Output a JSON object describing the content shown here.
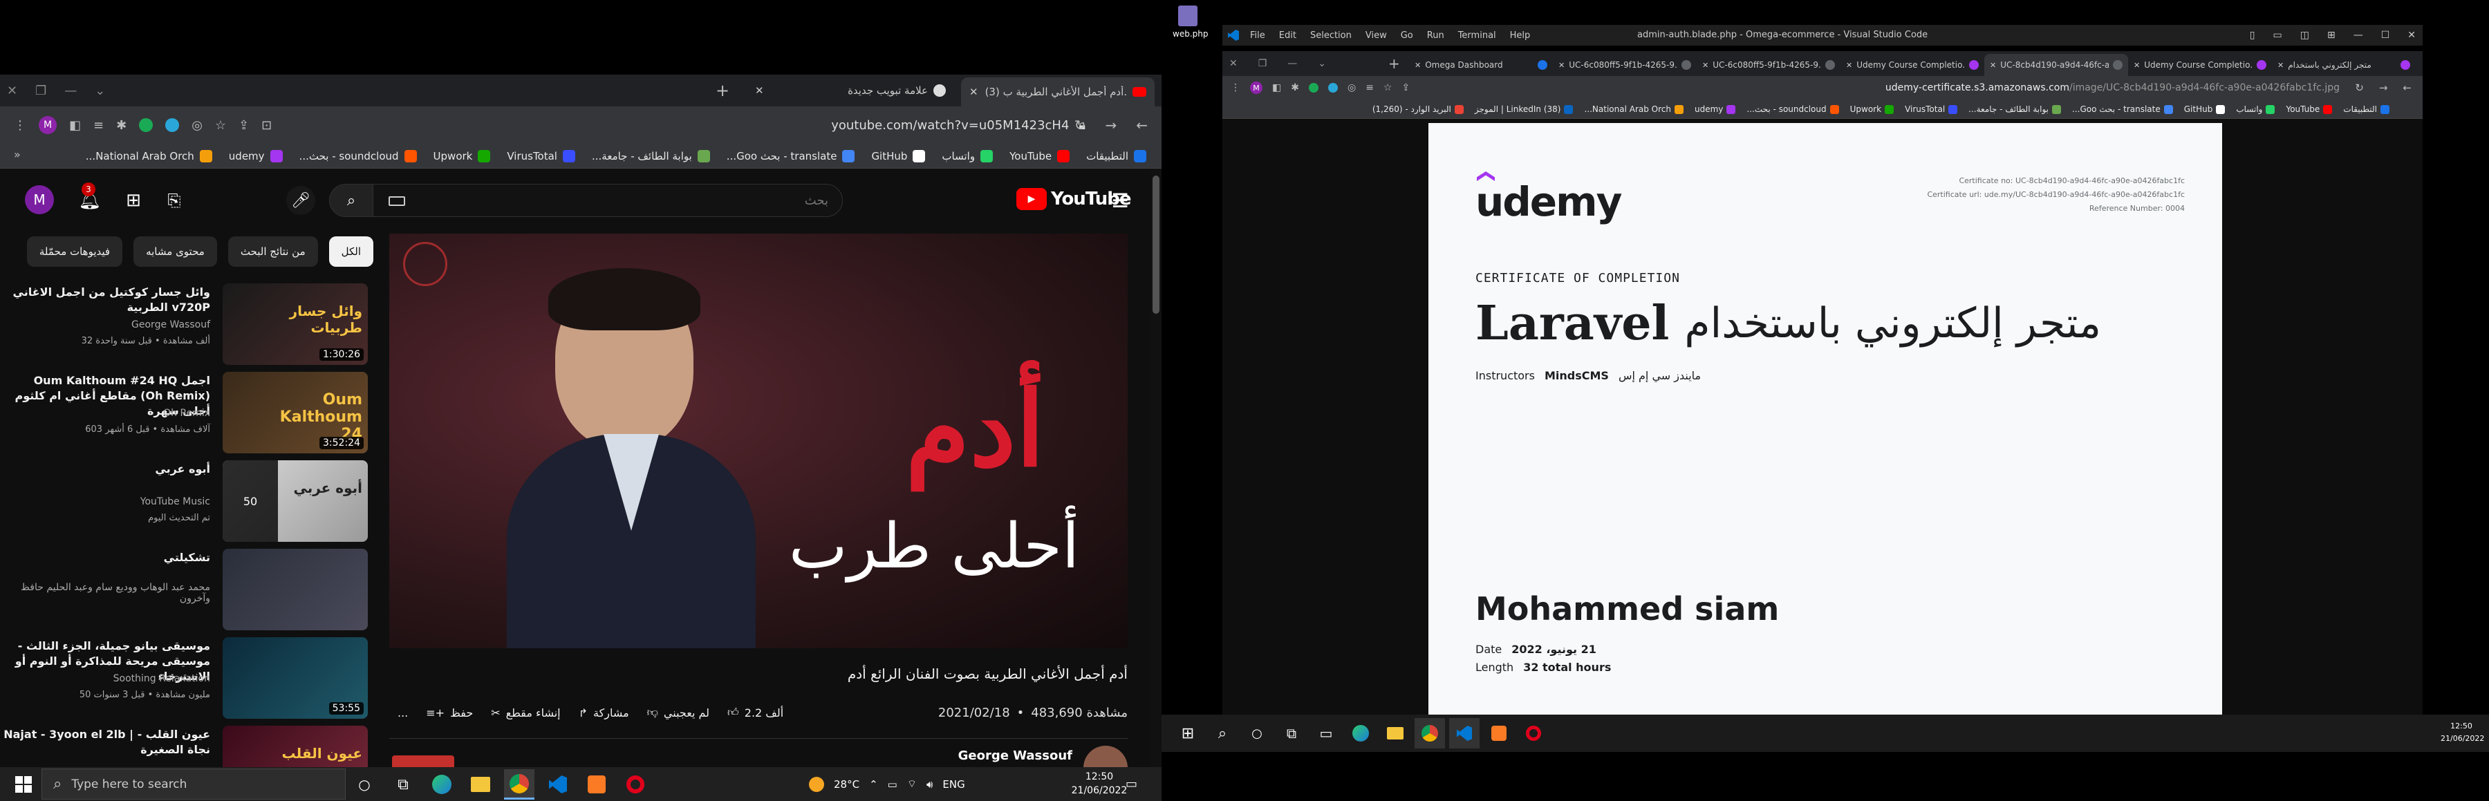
{
  "left_browser": {
    "tab_title": "(3) أدم أجمل الأغاني الطربية ب...",
    "tab2_title": "علامة تبويب جديدة",
    "url": "youtube.com/watch?v=u05M1423cH4",
    "bookmarks": [
      "التطبيقات",
      "YouTube",
      "واتساب",
      "GitHub",
      "translate - بحث Goo...",
      "بوابة الطائف - جامعة...",
      "VirusTotal",
      "Upwork",
      "soundcloud - بحث...",
      "udemy",
      "National Arab Orch..."
    ]
  },
  "youtube": {
    "logo": "YouTube",
    "search_placeholder": "بحث",
    "avatar_letter": "M",
    "notif_count": "3",
    "chips": [
      "الكل",
      "من نتائج البحث",
      "محتوى مشابه",
      "فيديوهات محمّلة"
    ],
    "thumb_big": "أدم",
    "thumb_small": "أحلى طرب",
    "video_title": "أدم أجمل الأغاني الطربية بصوت الفنان الرائع أدم",
    "date": "2021/02/18",
    "views": "483,690 مشاهدة",
    "likes": "2.2 ألف",
    "dislike": "لم يعجبني",
    "share": "مشاركة",
    "clip": "إنشاء مقطع",
    "save": "حفظ",
    "more": "...",
    "channel": "George Wassouf",
    "recs": [
      {
        "title": "وائل جسار كوكتيل من اجمل الاغاني الطربية v720P",
        "channel": "George Wassouf",
        "meta": "32 ألف مشاهدة • قبل سنة واحدة",
        "duration": "1:30:26",
        "thumb_text": "وائل جسار طربيات"
      },
      {
        "title": "Oum Kalthoum #24 HQ اجمل مقاطع أغاني ام كلثوم (Oh Remix) أحلى سهرة",
        "channel": "Oh Remix",
        "meta": "603 آلاف مشاهدة • قبل 6 أشهر",
        "duration": "3:52:24",
        "thumb_text": "Oum Kalthoum 24"
      },
      {
        "title": "أبوه عربي",
        "channel": "YouTube Music",
        "meta": "تم التحديث اليوم",
        "duration": "50",
        "thumb_text": "أبوه عربي"
      },
      {
        "title": "تشكيلتي",
        "channel": "محمد عبد الوهاب ووديع سام وعبد الحليم حافظ وآخرون",
        "meta": "",
        "duration": "",
        "thumb_text": ""
      },
      {
        "title": "موسيقى بيانو جميلة، الجزء الثالث - موسيقى مريحة للمذاكرة أو النوم أو الاسترخاء",
        "channel": "Soothing Relaxation",
        "meta": "50 مليون مشاهدة • قبل 3 سنوات",
        "duration": "53:55",
        "thumb_text": ""
      },
      {
        "title": "Najat - 3yoon el 2lb | عيون القلب - نجاة الصغيرة",
        "channel": "",
        "meta": "",
        "duration": "",
        "thumb_text": "عيون القلب"
      }
    ]
  },
  "taskbar_left": {
    "search": "Type here to search",
    "weather": "28°C",
    "lang": "ENG",
    "time": "12:50",
    "date": "21/06/2022"
  },
  "vscode": {
    "desktop_icon": "web.php",
    "menu": [
      "File",
      "Edit",
      "Selection",
      "View",
      "Go",
      "Run",
      "Terminal",
      "Help"
    ],
    "title": "admin-auth.blade.php - Omega-ecommerce - Visual Studio Code"
  },
  "right_browser": {
    "tabs": [
      "Omega Dashboard",
      "UC-6c080ff5-9f1b-4265-9...",
      "UC-6c080ff5-9f1b-4265-9...",
      "Udemy Course Completio...",
      "UC-8cb4d190-a9d4-46fc-a...",
      "Udemy Course Completio...",
      "متجر إلكتروني باستخدام"
    ],
    "url_host": "udemy-certificate.s3.amazonaws.com",
    "url_path": "/image/UC-8cb4d190-a9d4-46fc-a90e-a0426fabc1fc.jpg",
    "bookmarks": [
      "التطبيقات",
      "YouTube",
      "واتساب",
      "GitHub",
      "translate - بحث Goo...",
      "بوابة الطائف - جامعة...",
      "VirusTotal",
      "Upwork",
      "soundcloud - بحث...",
      "udemy",
      "National Arab Orch...",
      "(38) LinkedIn | الموجز",
      "البريد الوارد - (1,260)"
    ]
  },
  "certificate": {
    "logo": "udemy",
    "cert_no": "Certificate no: UC-8cb4d190-a9d4-46fc-a90e-a0426fabc1fc",
    "cert_url": "Certificate url: ude.my/UC-8cb4d190-a9d4-46fc-a90e-a0426fabc1fc",
    "ref": "Reference Number: 0004",
    "heading": "CERTIFICATE OF COMPLETION",
    "course_latin": "Laravel",
    "course_arabic": "متجر إلكتروني باستخدام",
    "instructors_label": "Instructors",
    "instructor": "MindsCMS",
    "instructor_ar": "مايندز سي إم إس",
    "name": "Mohammed siam",
    "date_label": "Date",
    "date_value": "21 يونيو، 2022",
    "length_label": "Length",
    "length_value": "32 total hours"
  },
  "taskbar_right": {
    "time": "12:50",
    "date": "21/06/2022"
  },
  "colors": {
    "yt_bg": "#0f0f0f",
    "yt_red": "#ff0000",
    "udemy_purple": "#a435f0",
    "cert_bg": "#f7f9fa",
    "vscode_blue": "#007acc"
  }
}
